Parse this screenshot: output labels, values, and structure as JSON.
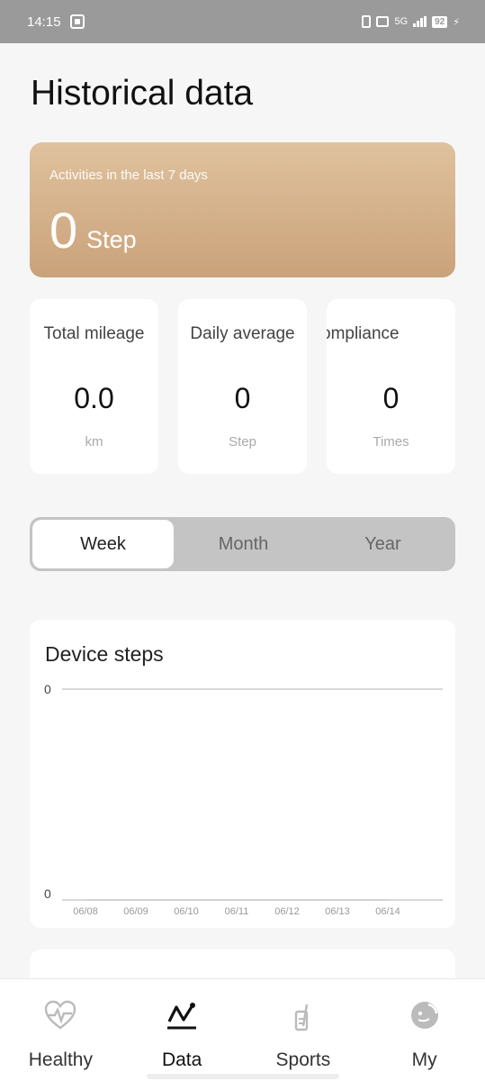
{
  "status_bar": {
    "time": "14:15",
    "network": "5G",
    "battery": "92"
  },
  "header": {
    "title": "Historical data"
  },
  "summary": {
    "caption": "Activities in the last 7 days",
    "value": "0",
    "unit": "Step"
  },
  "stats": [
    {
      "label": "Total mileage",
      "value": "0.0",
      "unit": "km"
    },
    {
      "label": "Daily average",
      "value": "0",
      "unit": "Step"
    },
    {
      "label": "ompliance",
      "value": "0",
      "unit": "Times"
    }
  ],
  "period_tabs": [
    {
      "label": "Week",
      "active": true
    },
    {
      "label": "Month",
      "active": false
    },
    {
      "label": "Year",
      "active": false
    }
  ],
  "chart_data": {
    "type": "line",
    "title": "Device steps",
    "categories": [
      "06/08",
      "06/09",
      "06/10",
      "06/11",
      "06/12",
      "06/13",
      "06/14"
    ],
    "values": [
      0,
      0,
      0,
      0,
      0,
      0,
      0
    ],
    "y_tick_labels": [
      "0",
      "0"
    ],
    "ylim": [
      0,
      0
    ],
    "grid": true,
    "colors": {
      "line": "#cccccc",
      "grid": "#cccccc",
      "tick_text": "#999999"
    }
  },
  "bottom_nav": [
    {
      "label": "Healthy",
      "icon": "heart-pulse-icon",
      "active": false
    },
    {
      "label": "Data",
      "icon": "data-trend-icon",
      "active": true
    },
    {
      "label": "Sports",
      "icon": "sports-icon",
      "active": false
    },
    {
      "label": "My",
      "icon": "profile-icon",
      "active": false
    }
  ],
  "colors": {
    "accent_gradient_top": "#dfc29e",
    "accent_gradient_bottom": "#caa27a",
    "background": "#f6f6f6"
  }
}
